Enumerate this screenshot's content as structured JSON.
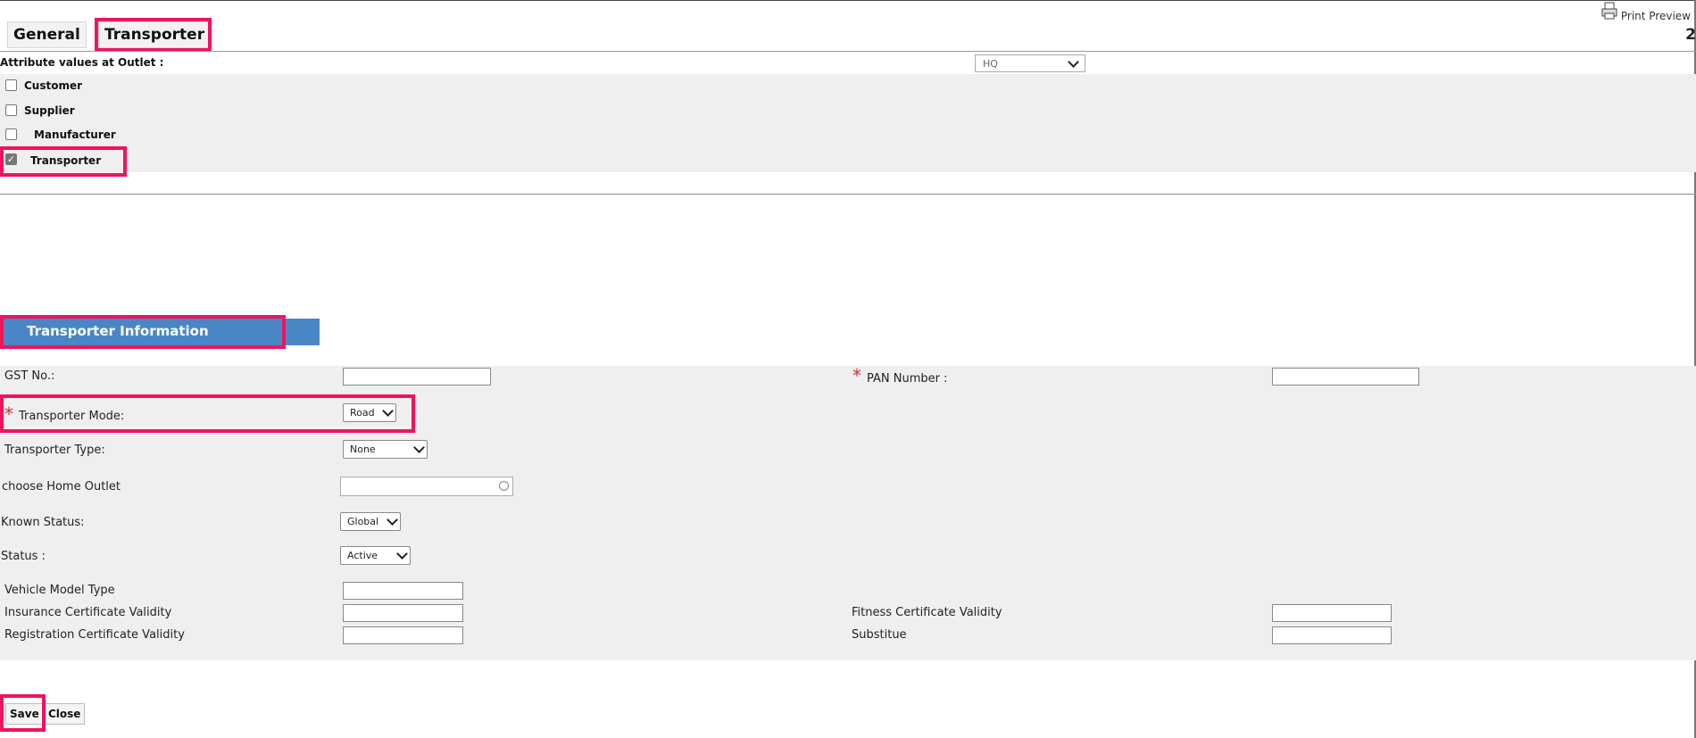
{
  "tabs": [
    {
      "label": "General"
    },
    {
      "label": "Transporter"
    }
  ],
  "print_preview_label": "Print Preview",
  "page_count": "2",
  "outlet": {
    "label": "Attribute values at Outlet :",
    "selected": "HQ"
  },
  "attributes": [
    {
      "label": "Customer",
      "checked": false
    },
    {
      "label": "Supplier",
      "checked": false
    },
    {
      "label": "Manufacturer",
      "checked": false
    },
    {
      "label": "Transporter",
      "checked": true
    }
  ],
  "section_title": "Transporter Information",
  "form": {
    "gst_label": "GST No.:",
    "gst_value": "",
    "pan_label": "PAN Number :",
    "pan_value": "",
    "mode_label": "Transporter Mode:",
    "mode_value": "Road",
    "type_label": "Transporter Type:",
    "type_value": "None",
    "home_outlet_label": "choose Home Outlet",
    "home_outlet_value": "",
    "known_status_label": "Known Status:",
    "known_status_value": "Global",
    "status_label": "Status :",
    "status_value": "Active",
    "vehicle_model_label": "Vehicle Model Type",
    "insurance_label": "Insurance Certificate Validity",
    "registration_label": "Registration Certificate Validity",
    "fitness_label": "Fitness Certificate Validity",
    "substitute_label": "Substitue",
    "required_mark": "*"
  },
  "buttons": {
    "save": "Save",
    "close": "Close"
  },
  "colors": {
    "highlight": "#f0145a",
    "section_header": "#4a86c5",
    "panel_bg": "#efefef",
    "required": "#e0262f"
  }
}
